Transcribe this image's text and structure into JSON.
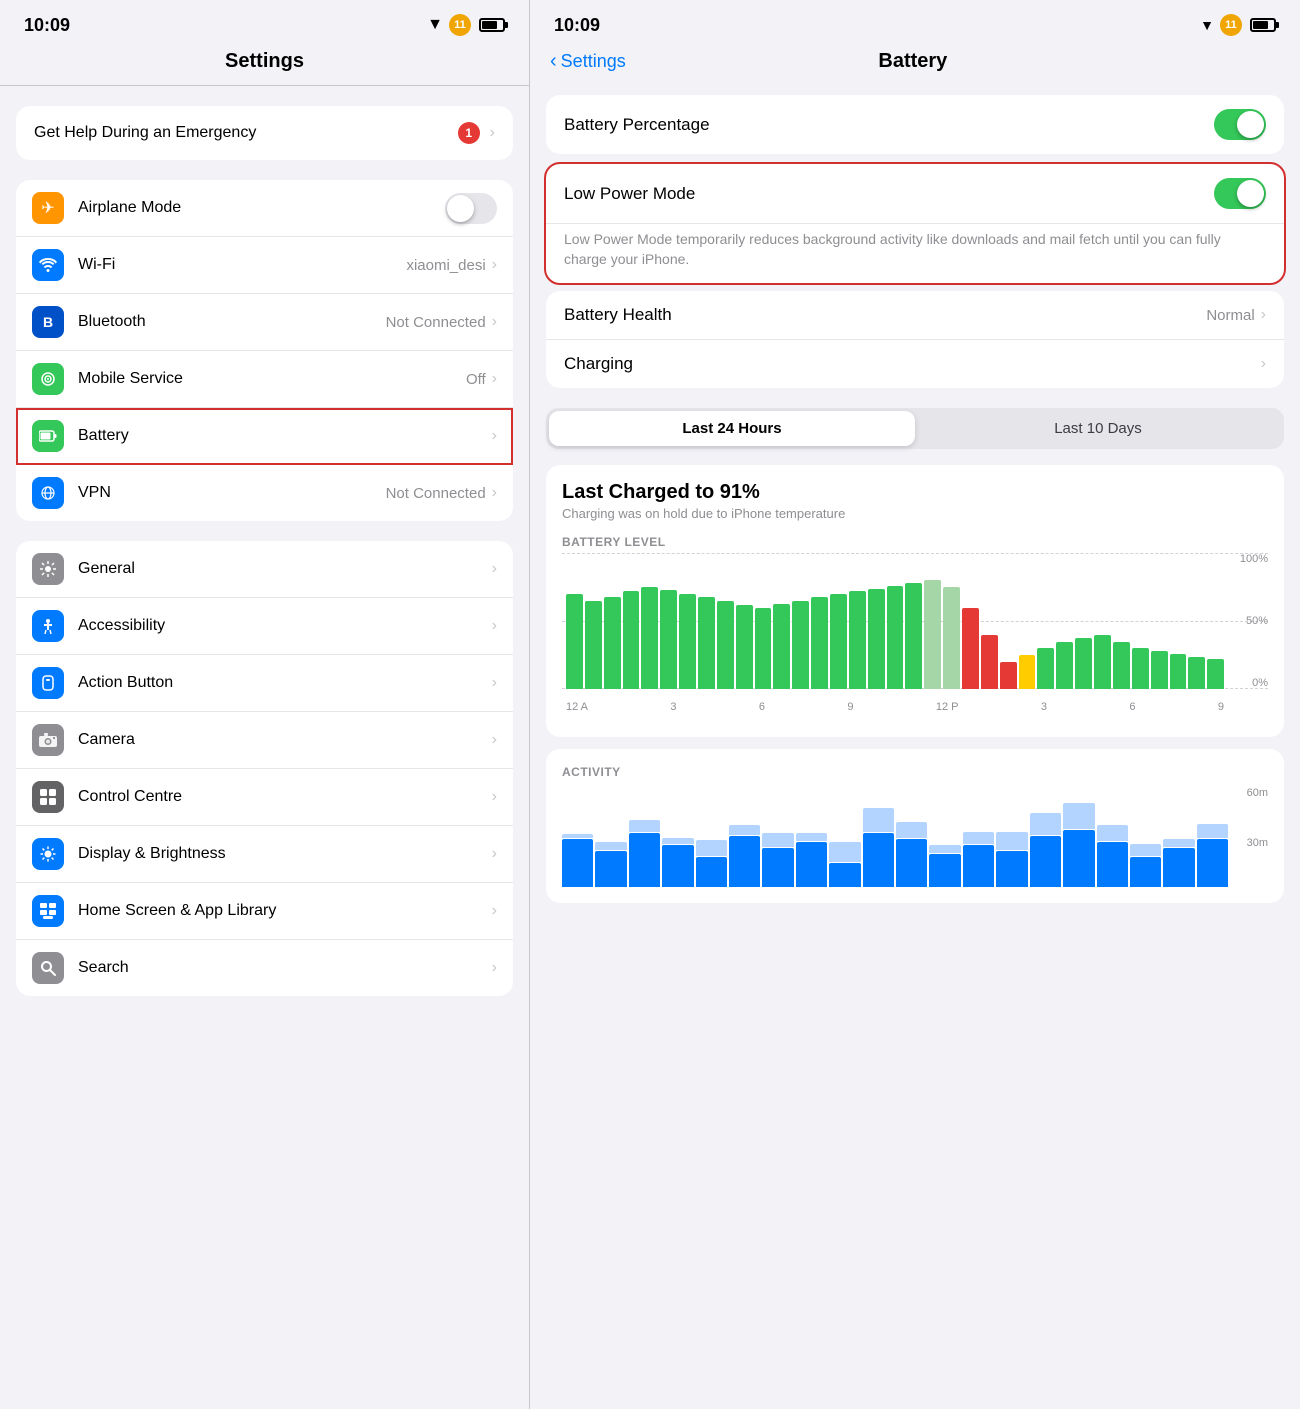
{
  "left": {
    "status_time": "10:09",
    "page_title": "Settings",
    "emergency": {
      "label": "Get Help During an Emergency",
      "badge": "1"
    },
    "network_group": [
      {
        "icon": "airplane",
        "icon_color": "icon-orange",
        "label": "Airplane Mode",
        "value": "",
        "has_toggle": true,
        "toggle_on": false
      },
      {
        "icon": "wifi",
        "icon_color": "icon-blue",
        "label": "Wi-Fi",
        "value": "xiaomi_desi",
        "has_chevron": true
      },
      {
        "icon": "bt",
        "icon_color": "icon-dark-blue",
        "label": "Bluetooth",
        "value": "Not Connected",
        "has_chevron": true
      },
      {
        "icon": "cell",
        "icon_color": "icon-green",
        "label": "Mobile Service",
        "value": "Off",
        "has_chevron": true
      },
      {
        "icon": "battery",
        "icon_color": "icon-green-battery",
        "label": "Battery",
        "value": "",
        "has_chevron": true,
        "highlight": true
      },
      {
        "icon": "globe",
        "icon_color": "icon-globe",
        "label": "VPN",
        "value": "Not Connected",
        "has_chevron": true
      }
    ],
    "general_group": [
      {
        "icon": "gear",
        "icon_color": "icon-gray",
        "label": "General",
        "has_chevron": true
      },
      {
        "icon": "accessibility",
        "icon_color": "icon-blue2",
        "label": "Accessibility",
        "has_chevron": true
      },
      {
        "icon": "action",
        "icon_color": "icon-blue2",
        "label": "Action Button",
        "has_chevron": true
      },
      {
        "icon": "camera",
        "icon_color": "icon-camera",
        "label": "Camera",
        "has_chevron": true
      },
      {
        "icon": "control",
        "icon_color": "icon-gray2",
        "label": "Control Centre",
        "has_chevron": true
      },
      {
        "icon": "brightness",
        "icon_color": "icon-blue2",
        "label": "Display & Brightness",
        "has_chevron": true
      },
      {
        "icon": "home",
        "icon_color": "icon-blue2",
        "label": "Home Screen & App Library",
        "has_chevron": true
      },
      {
        "icon": "search",
        "icon_color": "icon-search",
        "label": "Search",
        "has_chevron": true
      }
    ]
  },
  "right": {
    "status_time": "10:09",
    "back_label": "Settings",
    "page_title": "Battery",
    "battery_percentage_label": "Battery Percentage",
    "battery_percentage_on": true,
    "low_power_mode_label": "Low Power Mode",
    "low_power_mode_on": true,
    "low_power_desc": "Low Power Mode temporarily reduces background activity like downloads and mail fetch until you can fully charge your iPhone.",
    "battery_health_label": "Battery Health",
    "battery_health_value": "Normal",
    "charging_label": "Charging",
    "time_last24": "Last 24 Hours",
    "time_last10": "Last 10 Days",
    "last_charged_title": "Last Charged to 91%",
    "last_charged_sub": "Charging was on hold due to iPhone temperature",
    "battery_level_label": "BATTERY LEVEL",
    "activity_label": "ACTIVITY",
    "y_labels": [
      "100%",
      "50%",
      "0%"
    ],
    "x_labels": [
      "12 A",
      "3",
      "6",
      "9",
      "12 P",
      "3",
      "6",
      "9"
    ],
    "act_y_labels": [
      "60m",
      "30m"
    ],
    "bars": [
      70,
      65,
      68,
      72,
      75,
      73,
      70,
      68,
      65,
      62,
      60,
      63,
      65,
      68,
      70,
      72,
      74,
      76,
      78,
      80,
      75,
      60,
      40,
      20,
      25,
      30,
      35,
      38,
      40,
      35,
      30,
      28,
      26,
      24,
      22
    ],
    "bar_colors": [
      "g",
      "g",
      "g",
      "g",
      "g",
      "g",
      "g",
      "g",
      "g",
      "g",
      "g",
      "g",
      "g",
      "g",
      "g",
      "g",
      "g",
      "g",
      "g",
      "g",
      "g",
      "r",
      "r",
      "r",
      "y",
      "g",
      "g",
      "g",
      "g",
      "g",
      "g",
      "g",
      "g",
      "g",
      "g"
    ]
  }
}
